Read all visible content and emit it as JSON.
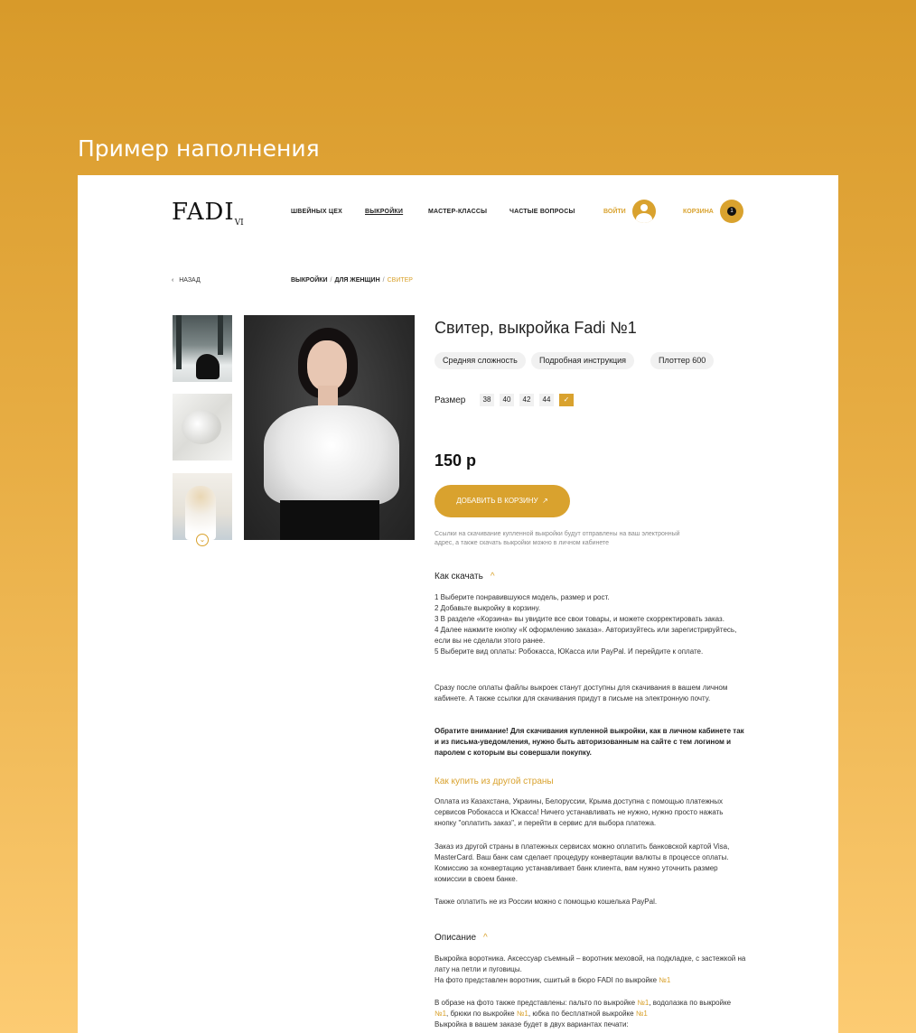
{
  "heading": "Пример наполнения",
  "header": {
    "logo": "FADI",
    "logo_sub": "VI",
    "nav": [
      "ШВЕЙНЫХ ЦЕХ",
      "ВЫКРОЙКИ",
      "МАСТЕР-КЛАССЫ",
      "ЧАСТЫЕ ВОПРОСЫ"
    ],
    "login": "ВОЙТИ",
    "cart": "КОРЗИНА",
    "cart_count": "1"
  },
  "breadcrumb": {
    "back": "НАЗАД",
    "items": [
      "ВЫКРОЙКИ",
      "ДЛЯ ЖЕНЩИН"
    ],
    "current": "СВИТЕР",
    "sep": "/"
  },
  "product": {
    "title": "Свитер, выкройка Fadi №1",
    "tags": [
      "Средняя сложность",
      "Подробная инструкция",
      "Плоттер 600"
    ],
    "size_label": "Размер",
    "sizes": [
      "38",
      "40",
      "42",
      "44",
      "✓"
    ],
    "price": "150 р",
    "add_to_cart": "ДОБАВИТЬ В КОРЗИНУ",
    "note": "Ссылки на скачивание купленной выкройки будут отправлены на ваш электронный адрес, а также скачать выкройки можно в личном кабинете"
  },
  "how_to": {
    "title": "Как скачать",
    "steps": [
      "1  Выберите понравившуюся модель, размер и рост.",
      "2  Добавьте выкройку в корзину.",
      "3  В разделе «Корзина» вы увидите все свои товары, и можете скорректировать заказ.",
      "4  Далее нажмите кнопку «К оформлению заказа». Авторизуйтесь или зарегистрируйтесь, если вы не сделали этого ранее.",
      "5  Выберите вид оплаты: Робокасса, ЮКасса или PayPal. И перейдите к оплате."
    ],
    "after": "Сразу после оплаты файлы выкроек станут доступны для скачивания в вашем личном кабинете. А также ссылки для скачивания придут в письме на электронную почту.",
    "warning": "Обратите внимание! Для скачивания купленной выкройки, как в личном кабинете так и из письма-уведомления, нужно быть авторизованным на сайте с тем логином и паролем с которым вы совершали покупку."
  },
  "abroad": {
    "title": "Как купить из другой страны",
    "p1": "Оплата из Казахстана, Украины, Белоруссии, Крыма доступна с помощью платежных сервисов Робокасса и Юкасса! Ничего устанавливать не нужно, нужно просто нажать кнопку \"оплатить заказ\", и перейти в сервис для выбора платежа.",
    "p2": "Заказ из другой страны в платежных сервисах можно оплатить банковской картой Visa, MasterCard. Ваш банк сам сделает процедуру конвертации валюты в процессе оплаты. Комиссию за конвертацию устанавливает банк клиента, вам нужно уточнить размер комиссии в своем банке.",
    "p3": "Также оплатить не из России можно с помощью кошелька PayPal."
  },
  "description": {
    "title": "Описание",
    "p1": "Выкройка воротника. Аксессуар съемный – воротник меховой, на подкладке, с застежкой на лату на петли и пуговицы.",
    "p1b": "На фото представлен воротник, сшитый в бюро FADI по выкройке ",
    "link": "№1",
    "p2a": "В образе на фото также представлены: пальто по выкройке ",
    "p2b": ", водолазка по выкройке ",
    "p2c": ", брюки по выкройке ",
    "p2d": ", юбка по бесплатной выкройке ",
    "p3": "Выкройка в вашем заказе будет в двух вариантах печати:"
  },
  "colors": {
    "accent": "#D9A22E",
    "background_top": "#D89A2A",
    "background_bottom": "#FCCB72"
  }
}
